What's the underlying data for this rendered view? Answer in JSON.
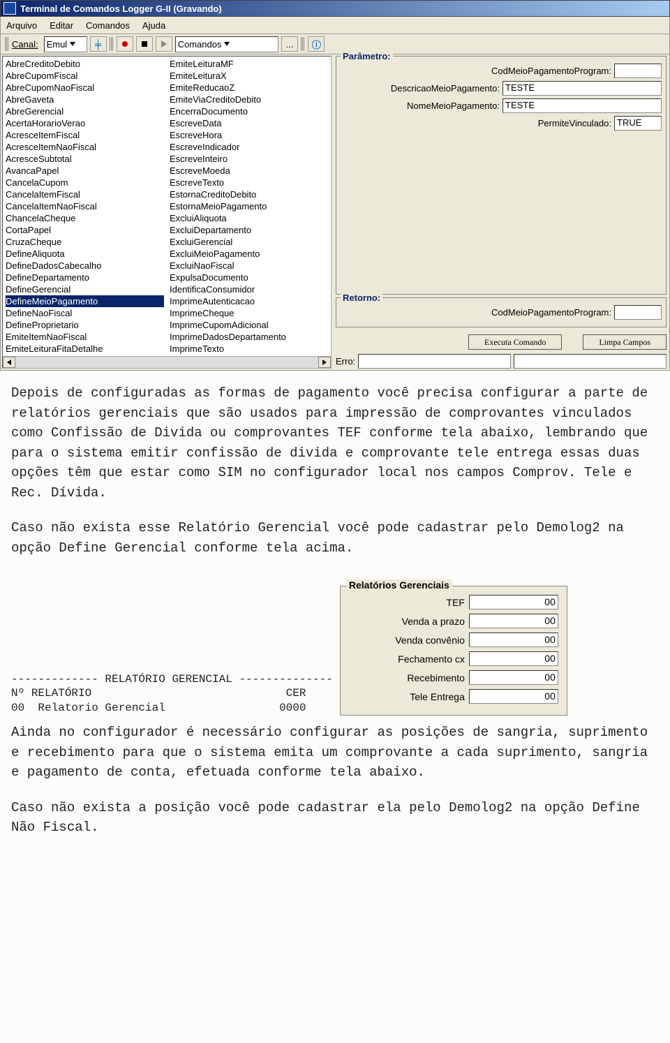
{
  "title": "Terminal de Comandos Logger G-II (Gravando)",
  "menu": {
    "m0": "Arquivo",
    "m1": "Editar",
    "m2": "Comandos",
    "m3": "Ajuda"
  },
  "toolbar": {
    "canal_label": "Canal:",
    "canal_value": "Emul",
    "comando_combo": "Comandos",
    "dots": "..."
  },
  "list": {
    "col1": [
      "AbreCreditoDebito",
      "AbreCupomFiscal",
      "AbreCupomNaoFiscal",
      "AbreGaveta",
      "AbreGerencial",
      "AcertaHorarioVerao",
      "AcresceItemFiscal",
      "AcresceItemNaoFiscal",
      "AcresceSubtotal",
      "AvancaPapel",
      "CancelaCupom",
      "CancelaItemFiscal",
      "CancelaItemNaoFiscal",
      "ChancelaCheque",
      "CortaPapel",
      "CruzaCheque",
      "DefineAliquota",
      "DefineDadosCabecalho",
      "DefineDepartamento",
      "DefineGerencial",
      "DefineMeioPagamento",
      "DefineNaoFiscal",
      "DefineProprietario",
      "EmiteItemNaoFiscal",
      "EmiteLeituraFitaDetalhe"
    ],
    "col2": [
      "EmiteLeituraMF",
      "EmiteLeituraX",
      "EmiteReducaoZ",
      "EmiteViaCreditoDebito",
      "EncerraDocumento",
      "EscreveData",
      "EscreveHora",
      "EscreveIndicador",
      "EscreveInteiro",
      "EscreveMoeda",
      "EscreveTexto",
      "EstornaCreditoDebito",
      "EstornaMeioPagamento",
      "ExcluiAliquota",
      "ExcluiDepartamento",
      "ExcluiGerencial",
      "ExcluiMeioPagamento",
      "ExcluiNaoFiscal",
      "ExpulsaDocumento",
      "IdentificaConsumidor",
      "ImprimeAutenticacao",
      "ImprimeCheque",
      "ImprimeCupomAdicional",
      "ImprimeDadosDepartamento",
      "ImprimeTexto"
    ],
    "selected": "DefineMeioPagamento"
  },
  "param": {
    "legend": "Parâmetro:",
    "p0": {
      "label": "CodMeioPagamentoProgram:",
      "value": ""
    },
    "p1": {
      "label": "DescricaoMeioPagamento:",
      "value": "TESTE"
    },
    "p2": {
      "label": "NomeMeioPagamento:",
      "value": "TESTE"
    },
    "p3": {
      "label": "PermiteVinculado:",
      "value": "TRUE"
    }
  },
  "retorno": {
    "legend": "Retorno:",
    "r0": {
      "label": "CodMeioPagamentoProgram:",
      "value": ""
    }
  },
  "buttons": {
    "exec": "Executa Comando",
    "limpa": "Limpa Campos"
  },
  "erro_label": "Erro:",
  "doc": {
    "p1": "Depois de configuradas as formas de pagamento você precisa configurar a parte de relatórios gerenciais que são usados para impressão de comprovantes vinculados como Confissão de Divida ou comprovantes TEF conforme tela abaixo, lembrando que para o sistema emitir confissão de divida e comprovante tele entrega essas duas opções têm que estar como SIM no configurador local nos campos Comprov. Tele e Rec. Dívida.",
    "p2": "Caso não exista esse Relatório Gerencial você pode cadastrar pelo Demolog2 na opção Define Gerencial conforme tela acima.",
    "p3": "Ainda no configurador é necessário configurar as posições de sangria, suprimento e recebimento para que o sistema emita um comprovante a cada suprimento, sangria e pagamento de conta, efetuada conforme tela abaixo.",
    "p4": "Caso não exista a posição você pode cadastrar ela pelo Demolog2 na opção Define Não Fiscal."
  },
  "receipt": {
    "line1": "------------- RELATÓRIO GERENCIAL --------------",
    "line2": "Nº RELATÓRIO                             CER",
    "line3": "00  Relatorio Gerencial                 0000"
  },
  "gerbox": {
    "title": "Relatórios Gerenciais",
    "r0": {
      "label": "TEF",
      "value": "00"
    },
    "r1": {
      "label": "Venda a prazo",
      "value": "00"
    },
    "r2": {
      "label": "Venda convênio",
      "value": "00"
    },
    "r3": {
      "label": "Fechamento cx",
      "value": "00"
    },
    "r4": {
      "label": "Recebimento",
      "value": "00"
    },
    "r5": {
      "label": "Tele Entrega",
      "value": "00"
    }
  }
}
